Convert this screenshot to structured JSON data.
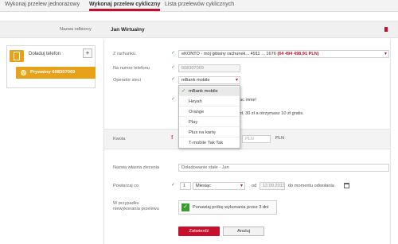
{
  "tabs": [
    {
      "label": "Wykonaj przelew jednorazowy"
    },
    {
      "label": "Wykonaj przelew cykliczny"
    },
    {
      "label": "Lista przelewów cyklicznych"
    }
  ],
  "recipient": {
    "label": "Nazwa odbiorcy",
    "value": "Jan Wirtualny"
  },
  "sidebar": {
    "topup_label": "Doładuj telefon",
    "add_symbol": "+",
    "account_label": "Prywatny 608307069"
  },
  "form": {
    "from_label": "Z rachunku",
    "from_value": "eKONTO - mój główny rachunek... 4911 ... 1676",
    "from_balance": "(64 494 498,91 PLN)",
    "phone_label": "Na numer telefonu",
    "phone_value": "608307069",
    "operator_label": "Operator sieci",
    "operator_value": "mBank mobile",
    "info_text_1": "ac mnie!",
    "info_text_2": "zł, 30 zł a otrzymasz 10 zł gratis.",
    "amount_label": "Kwota",
    "amount_placeholder": "PLN",
    "currency": "PLN",
    "title_label": "Nazwa własna zlecenia",
    "title_value": "Doładowanie stałe - Jan",
    "repeat_label": "Powtarzaj co",
    "repeat_count": "1",
    "repeat_unit": "Miesiąc",
    "from_date_label": "od",
    "from_date_value": "12.09.2013",
    "until_label": "do momentu odwołania",
    "failure_label_1": "W przypadku",
    "failure_label_2": "niewykonania przelewu",
    "retry_text": "Ponawiaj próbę wykonania przez 3 dni",
    "submit_label": "Zatwierdź",
    "cancel_label": "Anuluj"
  },
  "operator_options": [
    "mBank mobile",
    "Heyah",
    "Orange",
    "Play",
    "Plus na kartę",
    "T-mobile Tak Tak"
  ],
  "colors": {
    "accent": "#c8102e",
    "ok": "#3a9b2f",
    "account_badge": "#e8a21a"
  }
}
